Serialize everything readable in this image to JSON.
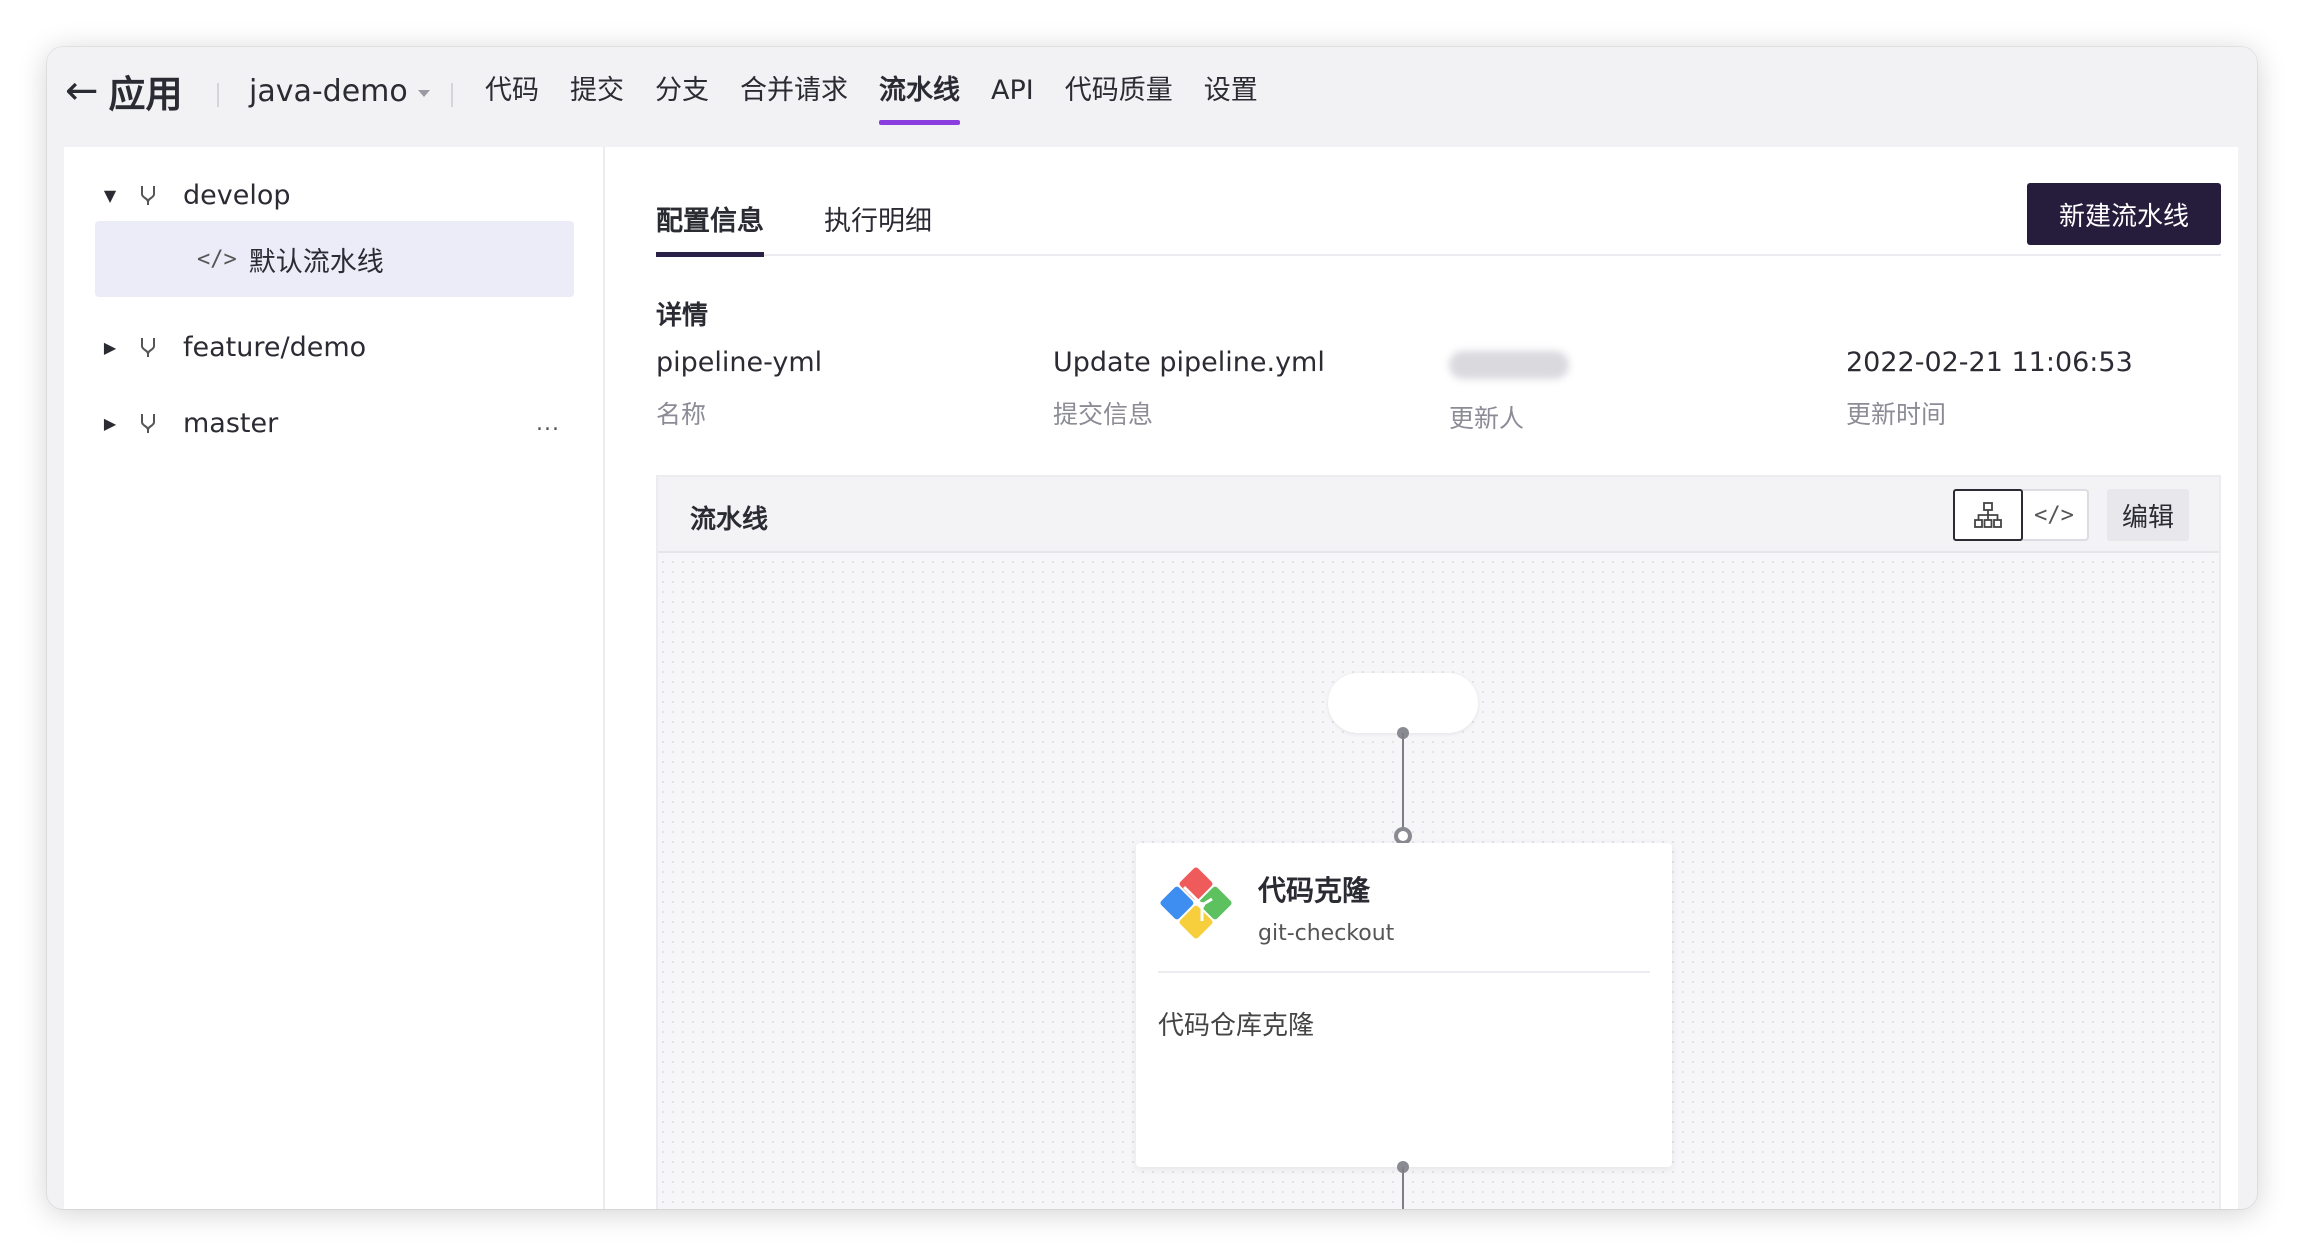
{
  "topbar": {
    "back_label": "应用",
    "app_name": "java-demo",
    "nav": [
      "代码",
      "提交",
      "分支",
      "合并请求",
      "流水线",
      "API",
      "代码质量",
      "设置"
    ],
    "active_nav": "流水线"
  },
  "tree": {
    "branches": [
      {
        "name": "develop",
        "expanded": true
      },
      {
        "name": "feature/demo",
        "expanded": false
      },
      {
        "name": "master",
        "expanded": false,
        "more": "..."
      }
    ],
    "pipeline_item": "默认流水线"
  },
  "tabs": [
    "配置信息",
    "执行明细"
  ],
  "new_pipeline_button": "新建流水线",
  "details": {
    "section_title": "详情",
    "name_value": "pipeline-yml",
    "name_key": "名称",
    "commit_value": "Update pipeline.yml",
    "commit_key": "提交信息",
    "updater_key": "更新人",
    "time_value": "2022-02-21 11:06:53",
    "time_key": "更新时间"
  },
  "pipeline": {
    "title": "流水线",
    "edit_button": "编辑",
    "task": {
      "name": "代码克隆",
      "id": "git-checkout",
      "description": "代码仓库克隆"
    }
  },
  "colors": {
    "accent": "#8a3ee0",
    "primary_button": "#261d3d",
    "selected_row": "#ecebf8"
  }
}
